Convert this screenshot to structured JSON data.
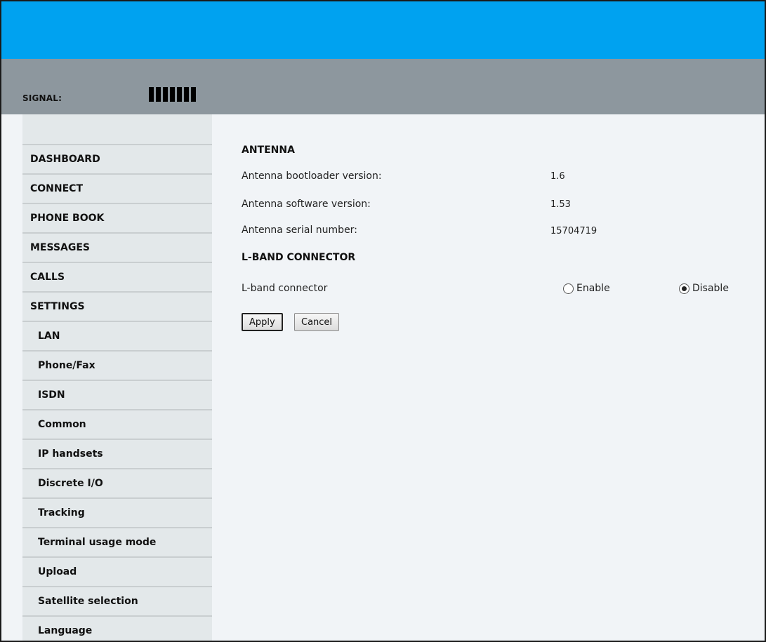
{
  "status": {
    "signal_label": "SIGNAL:",
    "signal_bars": 7
  },
  "sidebar": {
    "items": [
      {
        "label": "DASHBOARD"
      },
      {
        "label": "CONNECT"
      },
      {
        "label": "PHONE BOOK"
      },
      {
        "label": "MESSAGES"
      },
      {
        "label": "CALLS"
      },
      {
        "label": "SETTINGS"
      },
      {
        "label": "LAN"
      },
      {
        "label": "Phone/Fax"
      },
      {
        "label": "ISDN"
      },
      {
        "label": "Common"
      },
      {
        "label": "IP handsets"
      },
      {
        "label": "Discrete I/O"
      },
      {
        "label": "Tracking"
      },
      {
        "label": "Terminal usage mode"
      },
      {
        "label": "Upload"
      },
      {
        "label": "Satellite selection"
      },
      {
        "label": "Language"
      }
    ]
  },
  "antenna": {
    "title": "ANTENNA",
    "rows": [
      {
        "label": "Antenna bootloader version:",
        "value": "1.6"
      },
      {
        "label": "Antenna software version:",
        "value": "1.53"
      },
      {
        "label": "Antenna serial number:",
        "value": "15704719"
      }
    ]
  },
  "lband": {
    "title": "L-BAND CONNECTOR",
    "label": "L-band connector",
    "options": [
      {
        "label": "Enable",
        "checked": false
      },
      {
        "label": "Disable",
        "checked": true
      }
    ]
  },
  "buttons": {
    "apply": "Apply",
    "cancel": "Cancel"
  },
  "colors": {
    "top_band": "#00a2f0",
    "status_bar": "#8d979e",
    "sidebar": "#e3e8ea",
    "content_bg": "#f1f4f7"
  }
}
